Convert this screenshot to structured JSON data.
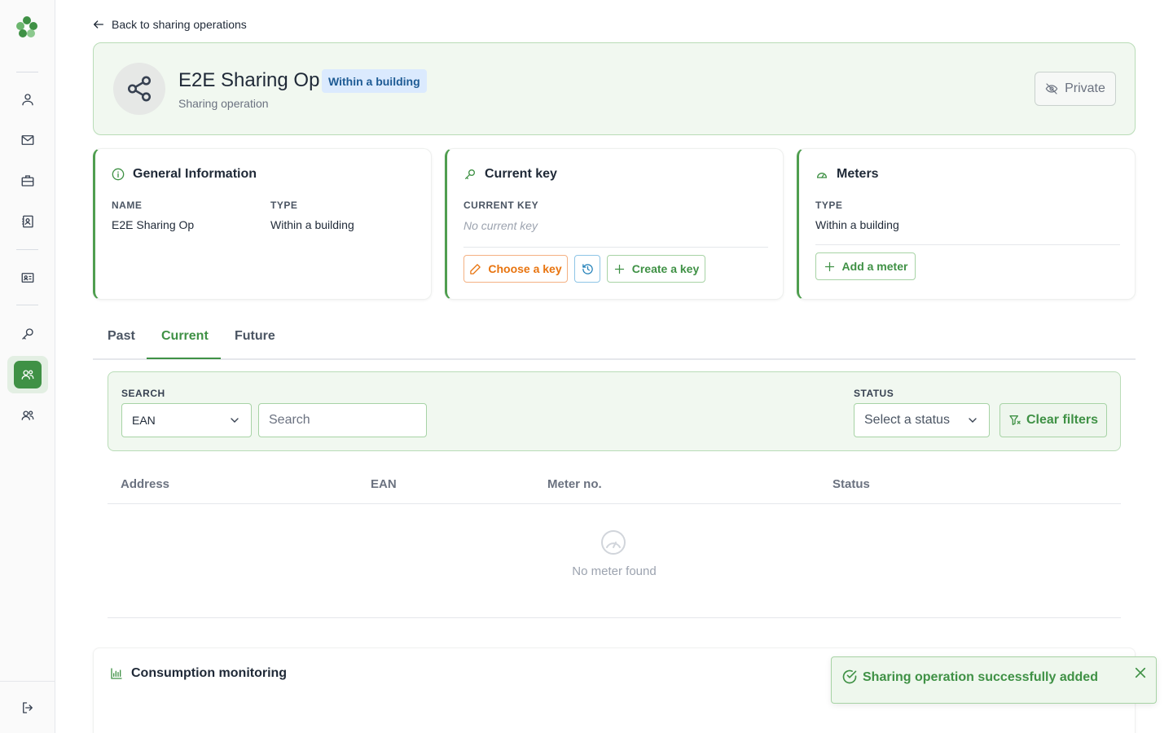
{
  "colors": {
    "accent": "#3f9145",
    "header_bg": "#f1f8f0",
    "badge_bg": "#dbeafe",
    "orange": "#e8740f",
    "blue": "#1f7fb8"
  },
  "sidebar": {
    "items": [
      {
        "icon": "user-icon"
      },
      {
        "icon": "mail-icon"
      },
      {
        "icon": "briefcase-icon"
      },
      {
        "icon": "contacts-icon"
      },
      {
        "icon": "id-card-icon"
      },
      {
        "icon": "key-icon"
      },
      {
        "icon": "users-icon",
        "active": true
      },
      {
        "icon": "group-icon"
      }
    ],
    "logout_icon": "logout-icon"
  },
  "back_link": "Back to sharing operations",
  "header": {
    "title": "E2E Sharing Op",
    "badge": "Within a building",
    "subtitle": "Sharing operation",
    "private_label": "Private"
  },
  "general_info": {
    "title": "General Information",
    "name_label": "NAME",
    "name_value": "E2E Sharing Op",
    "type_label": "TYPE",
    "type_value": "Within a building"
  },
  "current_key": {
    "title": "Current key",
    "label": "CURRENT KEY",
    "value": "No current key",
    "choose_label": "Choose a key",
    "create_label": "Create a key"
  },
  "meters": {
    "title": "Meters",
    "type_label": "TYPE",
    "type_value": "Within a building",
    "add_label": "Add a meter"
  },
  "tabs": [
    {
      "label": "Past"
    },
    {
      "label": "Current",
      "active": true
    },
    {
      "label": "Future"
    }
  ],
  "filters": {
    "search_label": "SEARCH",
    "search_field": "EAN",
    "search_placeholder": "Search",
    "status_label": "STATUS",
    "status_placeholder": "Select a status",
    "clear_label": "Clear filters"
  },
  "table": {
    "columns": [
      "Address",
      "EAN",
      "Meter no.",
      "Status"
    ],
    "empty_text": "No meter found"
  },
  "consumption": {
    "title": "Consumption monitoring"
  },
  "toast": {
    "text": "Sharing operation successfully added"
  }
}
